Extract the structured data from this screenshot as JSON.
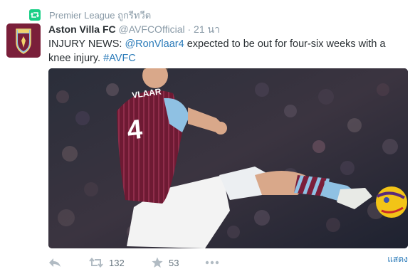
{
  "context": {
    "text": "Premier League ถูกรีทวีต"
  },
  "tweet": {
    "fullname": "Aston Villa FC",
    "handle": "@AVFCOfficial",
    "separator": "·",
    "time": "21 นา",
    "text_before": "INJURY NEWS: ",
    "mention": "@RonVlaar4",
    "text_middle": " expected to be out for four-six weeks with a knee injury. ",
    "hashtag": "#AVFC"
  },
  "photo": {
    "shirt_name": "VLAAR",
    "shirt_number": "4"
  },
  "actions": {
    "retweet_count": "132",
    "favorite_count": "53",
    "see_more": "แสดง"
  },
  "colors": {
    "link": "#2b7bb9",
    "meta": "#8899a6",
    "claret": "#7a1f3a",
    "sky_blue": "#8fc1e3"
  }
}
